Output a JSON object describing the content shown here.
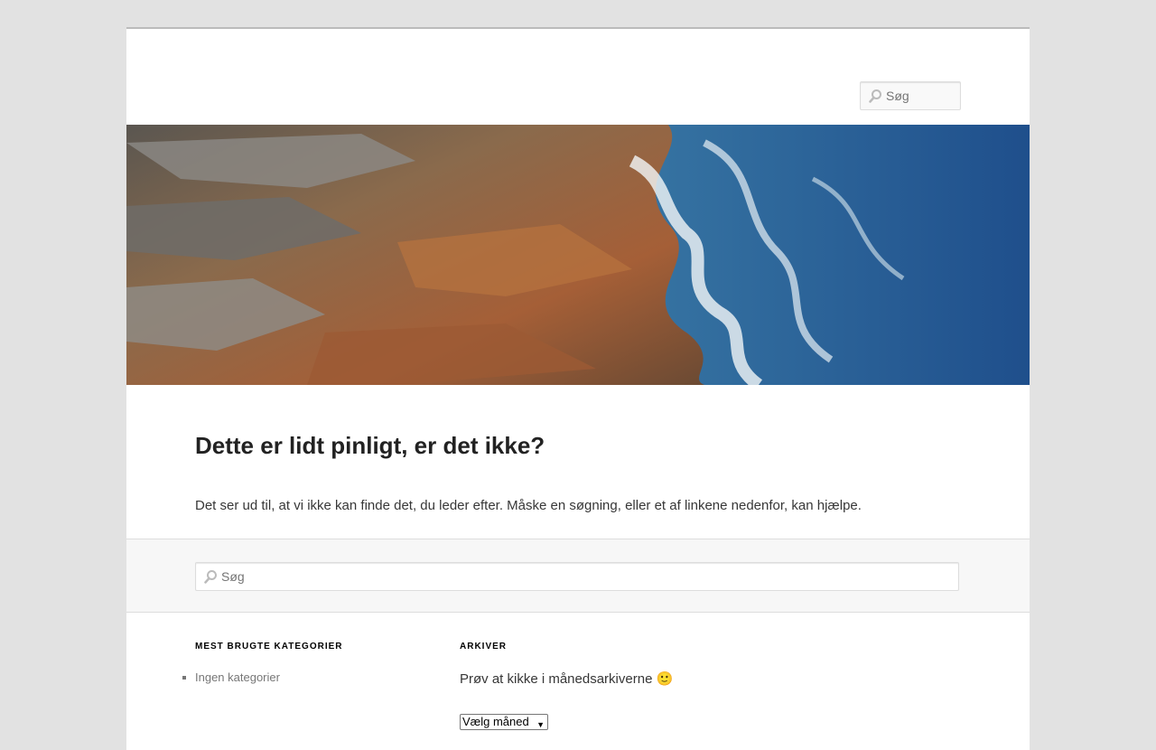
{
  "header": {
    "search_placeholder": "Søg"
  },
  "main": {
    "title": "Dette er lidt pinligt, er det ikke?",
    "text": "Det ser ud til, at vi ikke kan finde det, du leder efter. Måske en søgning, eller et af linkene nedenfor, kan hjælpe.",
    "search_placeholder": "Søg"
  },
  "widgets": {
    "categories": {
      "title": "MEST BRUGTE KATEGORIER",
      "items": [
        "Ingen kategorier"
      ]
    },
    "archives": {
      "title": "ARKIVER",
      "text": "Prøv at kikke i månedsarkiverne 🙂",
      "select_value": "Vælg måned"
    }
  },
  "icons": {
    "search": "search-icon",
    "dropdown": "chevron-down-icon"
  },
  "colors": {
    "page_background": "#e2e2e2",
    "content_background": "#ffffff",
    "search_band": "#f7f7f7",
    "title": "#222222"
  }
}
